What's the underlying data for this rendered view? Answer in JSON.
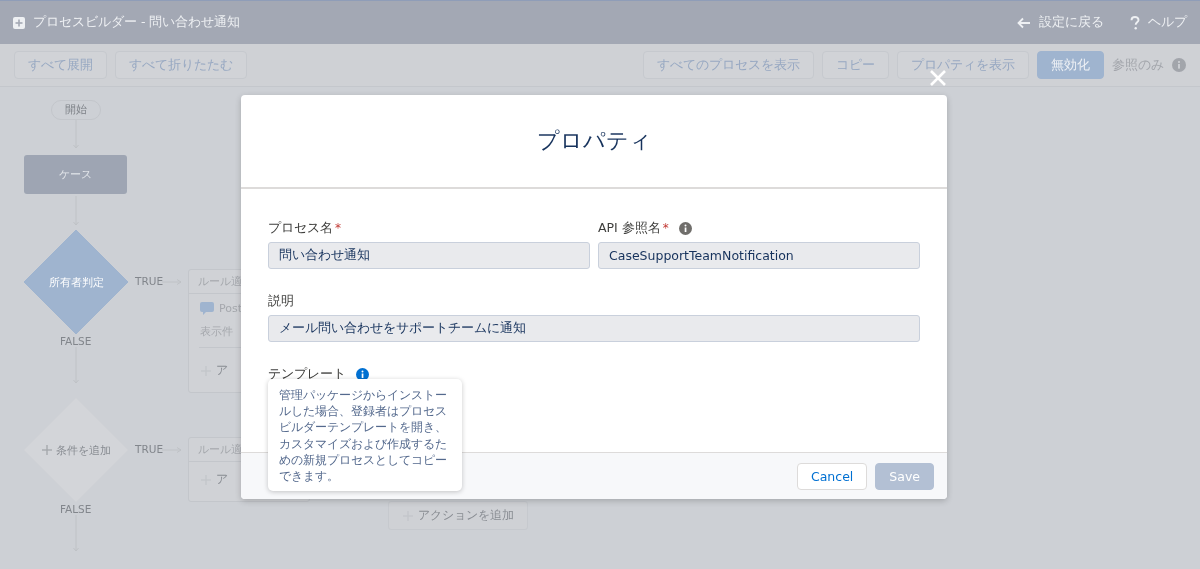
{
  "window": {
    "title": "プロセスビルダー - 問い合わせ通知"
  },
  "header_links": [
    {
      "kind": "back",
      "label": "設定に戻る"
    },
    {
      "kind": "help",
      "label": "ヘルプ"
    }
  ],
  "toolbar": {
    "left_buttons": [
      "すべて展開",
      "すべて折りたたむ"
    ],
    "right_buttons": [
      {
        "label": "すべてのプロセスを表示",
        "primary": false
      },
      {
        "label": "コピー",
        "primary": false
      },
      {
        "label": "プロパティを表示",
        "primary": false
      },
      {
        "label": "無効化",
        "primary": true
      }
    ],
    "status": "参照のみ"
  },
  "flow": {
    "start": "開始",
    "object": "ケース",
    "criteria": [
      {
        "label": "所有者判定",
        "defined": true,
        "true_label": "TRUE",
        "false_label": "FALSE",
        "rule_title": "ルール適",
        "action": "Post",
        "info": "表示件",
        "add_action": "ア"
      },
      {
        "label": "条件を追加",
        "defined": false,
        "true_label": "TRUE",
        "false_label": "FALSE",
        "rule_title": "ルール適",
        "add_action": "ア"
      }
    ],
    "add_action_button": "アクションを追加"
  },
  "modal": {
    "title": "プロパティ",
    "fields": [
      {
        "label": "プロセス名",
        "required_mark": "*",
        "info": false,
        "value": "問い合わせ通知"
      },
      {
        "label": "API 参照名",
        "required_mark": "*",
        "info": true,
        "value": "CaseSupportTeamNotification"
      }
    ],
    "description": {
      "label": "説明",
      "value": "メール問い合わせをサポートチームに通知"
    },
    "template": {
      "label": "テンプレート",
      "tooltip": "管理パッケージからインストールした場合、登録者はプロセスビルダーテンプレートを開き、カスタマイズおよび作成するための新規プロセスとしてコピーできます。"
    },
    "buttons": [
      {
        "label": "Cancel",
        "disabled": false
      },
      {
        "label": "Save",
        "disabled": true
      }
    ]
  }
}
